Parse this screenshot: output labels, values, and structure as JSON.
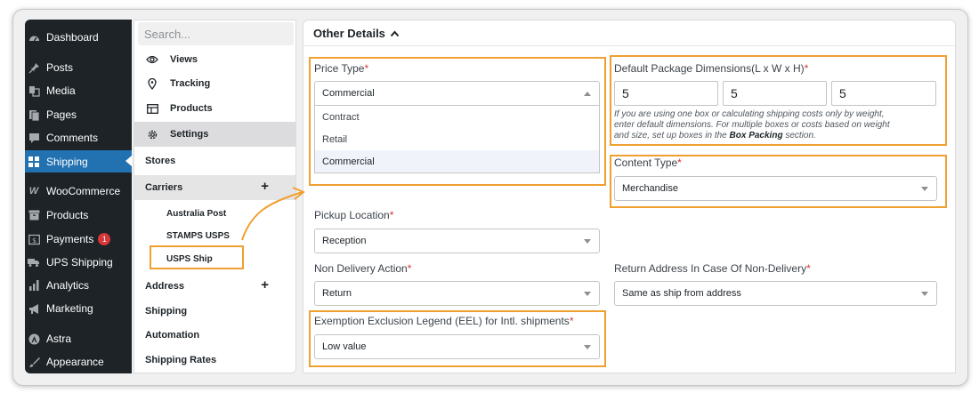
{
  "wp_menu": [
    {
      "label": "Dashboard",
      "icon": "dashboard-icon"
    },
    {
      "label": "Posts",
      "icon": "pin-icon"
    },
    {
      "label": "Media",
      "icon": "media-icon"
    },
    {
      "label": "Pages",
      "icon": "pages-icon"
    },
    {
      "label": "Comments",
      "icon": "comment-icon"
    },
    {
      "label": "Shipping",
      "icon": "grid-icon",
      "active": true
    },
    {
      "label": "WooCommerce",
      "icon": "woo-icon"
    },
    {
      "label": "Products",
      "icon": "archive-icon"
    },
    {
      "label": "Payments",
      "icon": "dollar-icon",
      "badge": "1"
    },
    {
      "label": "UPS Shipping",
      "icon": "truck-icon"
    },
    {
      "label": "Analytics",
      "icon": "bar-chart-icon"
    },
    {
      "label": "Marketing",
      "icon": "megaphone-icon"
    },
    {
      "label": "Astra",
      "icon": "astra-icon"
    },
    {
      "label": "Appearance",
      "icon": "brush-icon"
    }
  ],
  "subnav": {
    "search_placeholder": "Search...",
    "items": [
      {
        "label": "Views",
        "icon": "eye-icon"
      },
      {
        "label": "Tracking",
        "icon": "location-pin-icon"
      },
      {
        "label": "Products",
        "icon": "product-table-icon"
      },
      {
        "label": "Settings",
        "icon": "gear-icon"
      }
    ],
    "stores": "Stores",
    "carriers": "Carriers",
    "carrier_list": [
      "Australia Post",
      "STAMPS USPS",
      "USPS Ship"
    ],
    "address": "Address",
    "shipping": "Shipping",
    "automation": "Automation",
    "shipping_rates": "Shipping Rates"
  },
  "section": {
    "title": "Other Details"
  },
  "price_type": {
    "label": "Price Type",
    "value": "Commercial",
    "options": [
      "Contract",
      "Retail",
      "Commercial"
    ],
    "selected_index": 2
  },
  "dimensions": {
    "label": "Default Package Dimensions(L x W x H)",
    "values": [
      "5",
      "5",
      "5"
    ],
    "hint_lines": [
      "If you are using one box or calculating shipping costs only by weight,",
      "enter default dimensions. For multiple boxes or costs based on weight",
      "and size, set up boxes in the "
    ],
    "hint_bold": "Box Packing",
    "hint_end": " section."
  },
  "content_type": {
    "label": "Content Type",
    "value": "Merchandise"
  },
  "pickup_location": {
    "label": "Pickup Location",
    "value": "Reception"
  },
  "non_delivery": {
    "label": "Non Delivery Action",
    "value": "Return"
  },
  "return_address": {
    "label": "Return Address In Case Of Non-Delivery",
    "value": "Same as ship from address"
  },
  "eel": {
    "label": "Exemption Exclusion Legend (EEL) for Intl. shipments",
    "value": "Low value"
  },
  "required_mark": "*",
  "colors": {
    "accent": "#2271b1",
    "highlight": "#f0a030",
    "required": "#d63638",
    "sidebar": "#1d2327"
  }
}
